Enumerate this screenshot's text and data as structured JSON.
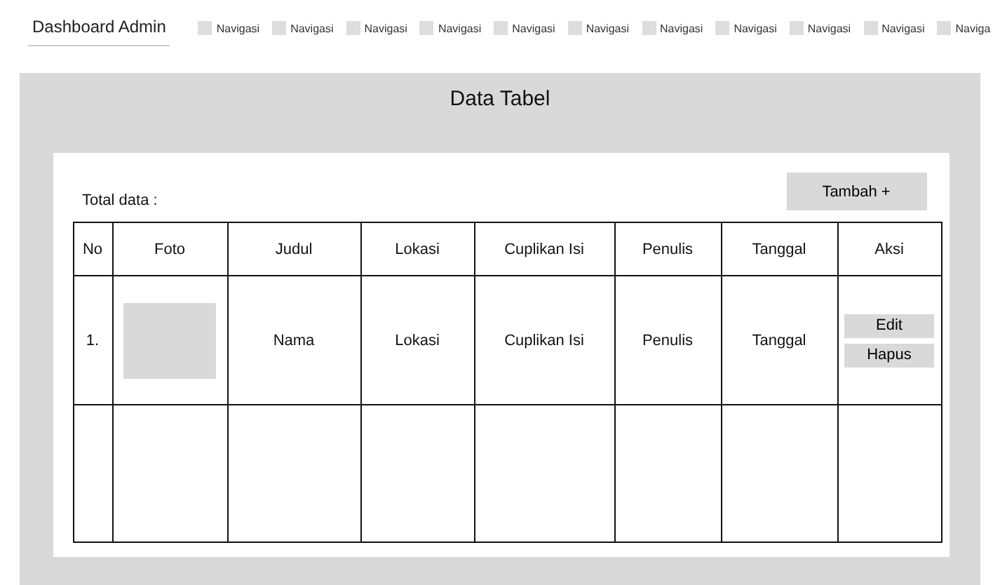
{
  "header": {
    "title": "Dashboard Admin",
    "nav": [
      "Navigasi",
      "Navigasi",
      "Navigasi",
      "Navigasi",
      "Navigasi",
      "Navigasi",
      "Navigasi",
      "Navigasi",
      "Navigasi",
      "Navigasi",
      "Naviga"
    ]
  },
  "page_title": "Data Tabel",
  "total_label": "Total data :",
  "add_button": "Tambah +",
  "table": {
    "columns": [
      "No",
      "Foto",
      "Judul",
      "Lokasi",
      "Cuplikan Isi",
      "Penulis",
      "Tanggal",
      "Aksi"
    ],
    "rows": [
      {
        "no": "1.",
        "judul": "Nama",
        "lokasi": "Lokasi",
        "cuplikan": "Cuplikan Isi",
        "penulis": "Penulis",
        "tanggal": "Tanggal",
        "actions": [
          "Edit",
          "Hapus"
        ]
      }
    ]
  }
}
